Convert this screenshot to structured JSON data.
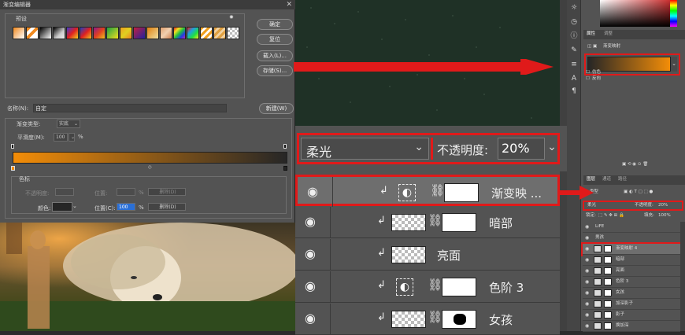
{
  "gradient_editor": {
    "title": "渐变编辑器",
    "close_glyph": "✕",
    "presets_label": "预设",
    "gear_glyph": "✹",
    "buttons": {
      "ok": "确定",
      "reset": "复位",
      "load": "载入(L)...",
      "save": "存储(S)...",
      "new": "新建(W)",
      "delete1": "删除(D)",
      "delete2": "删除(D)"
    },
    "name_label": "名称(N):",
    "name_value": "自定",
    "gradient_type_label": "渐变类型:",
    "gradient_type_value": "实底",
    "smoothness_label": "平滑度(M):",
    "smoothness_value": "100",
    "percent": "%",
    "color_stops_label": "色标",
    "opacity_label": "不透明度:",
    "location_label": "位置:",
    "color_label": "颜色:",
    "location_c_label": "位置(C):",
    "location_c_value": "100",
    "gradient_start": "#f38d08",
    "gradient_end": "#262626"
  },
  "canvas": {
    "color": "#1f3126"
  },
  "blend_panel": {
    "blend_mode": "柔光",
    "opacity_label": "不透明度:",
    "opacity_value": "20%"
  },
  "big_layers": [
    {
      "name": "渐变映 ...",
      "type": "adjust",
      "selected": true
    },
    {
      "name": "暗部",
      "type": "mask"
    },
    {
      "name": "亮面",
      "type": "plain"
    },
    {
      "name": "色阶 3",
      "type": "adjust"
    },
    {
      "name": "女孩",
      "type": "mask2"
    }
  ],
  "properties": {
    "tab1": "属性",
    "tab2": "调整",
    "header": "渐变映射",
    "check1": "仿色",
    "check2": "反向"
  },
  "layers_panel": {
    "tab1": "图层",
    "tab2": "通道",
    "tab3": "路径",
    "kind": "类型",
    "blend": "柔光",
    "opacity_label": "不透明度:",
    "opacity_value": "20%",
    "lock_label": "锁定:",
    "fill_label": "填充:",
    "fill_value": "100%",
    "items": [
      "LiFE",
      "男孩",
      "渐变映射 4",
      "暗部",
      "亮面",
      "色阶 3",
      "女孩",
      "加深影子",
      "影子",
      "换加深"
    ]
  }
}
